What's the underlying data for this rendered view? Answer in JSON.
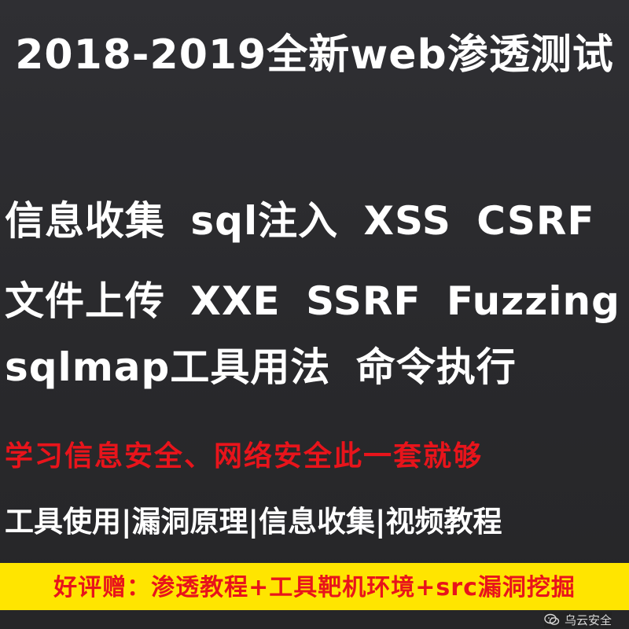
{
  "headline": "2018-2019全新web渗透测试",
  "topics": {
    "row1": "信息收集 sql注入 XSS CSRF",
    "row2": "文件上传 XXE SSRF Fuzzing",
    "row3": "sqlmap工具用法 命令执行"
  },
  "slogan": "学习信息安全、网络安全此一套就够",
  "tags": "工具使用|漏洞原理|信息收集|视频教程",
  "bonus": "好评赠：渗透教程+工具靶机环境+src漏洞挖掘",
  "watermark": {
    "icon": "wechat-icon",
    "text": "乌云安全"
  },
  "colors": {
    "background": "#2b2b2e",
    "text": "#ffffff",
    "accent_red": "#e8141b",
    "bonus_bar": "#ffe500"
  }
}
